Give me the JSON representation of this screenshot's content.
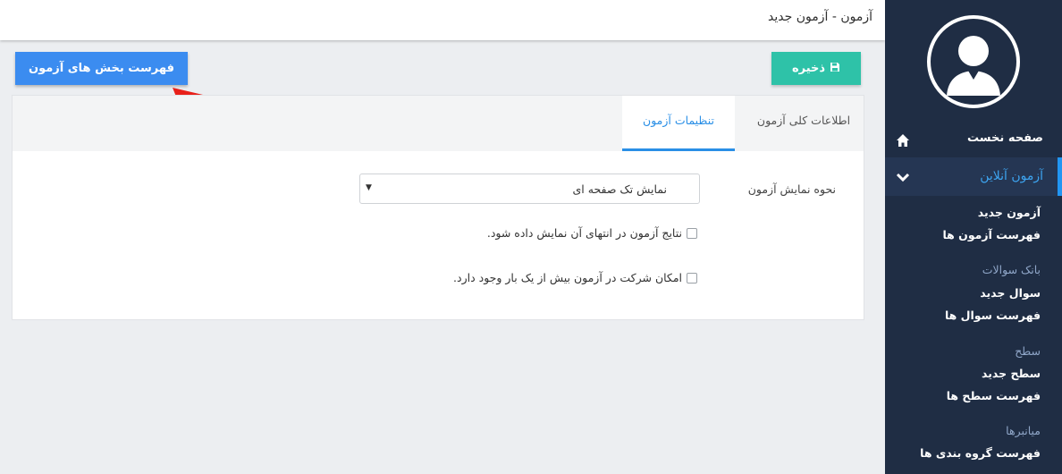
{
  "header": {
    "title": "آزمون - آزمون جدید"
  },
  "toolbar": {
    "sections_label": "فهرست بخش های آزمون",
    "save_label": "ذخیره"
  },
  "tabs": [
    {
      "label": "اطلاعات کلی آزمون",
      "active": false
    },
    {
      "label": "تنظیمات آزمون",
      "active": true
    }
  ],
  "settings": {
    "display_mode_label": "نحوه نمایش آزمون",
    "display_mode_value": "نمایش تک صفحه ای",
    "show_results_label": "نتایج آزمون در انتهای آن نمایش داده شود.",
    "show_results_checked": false,
    "multiple_attempts_label": "امکان شرکت در آزمون بیش از یک بار وجود دارد.",
    "multiple_attempts_checked": false
  },
  "sidebar": {
    "home": "صفحه نخست",
    "online_exam": "آزمون آنلاین",
    "exam_items": [
      "آزمون جدید",
      "فهرست آزمون ها"
    ],
    "question_bank": {
      "title": "بانک سوالات",
      "items": [
        "سوال جدید",
        "فهرست سوال ها"
      ]
    },
    "levels": {
      "title": "سطح",
      "items": [
        "سطح جدید",
        "فهرست سطح ها"
      ]
    },
    "shortcuts": {
      "title": "میانبرها",
      "items": [
        "فهرست گروه بندی ها"
      ]
    }
  },
  "colors": {
    "sidebar_bg": "#1f2d44",
    "primary_button": "#3b8cf0",
    "save_button": "#2ec2a8",
    "active_tab": "#2a8fe6",
    "annotation_arrow": "#e8201a"
  },
  "icons": {
    "home": "home-icon",
    "expand": "chevron-down-icon",
    "save": "floppy-disk-icon",
    "avatar": "user-avatar-icon"
  }
}
